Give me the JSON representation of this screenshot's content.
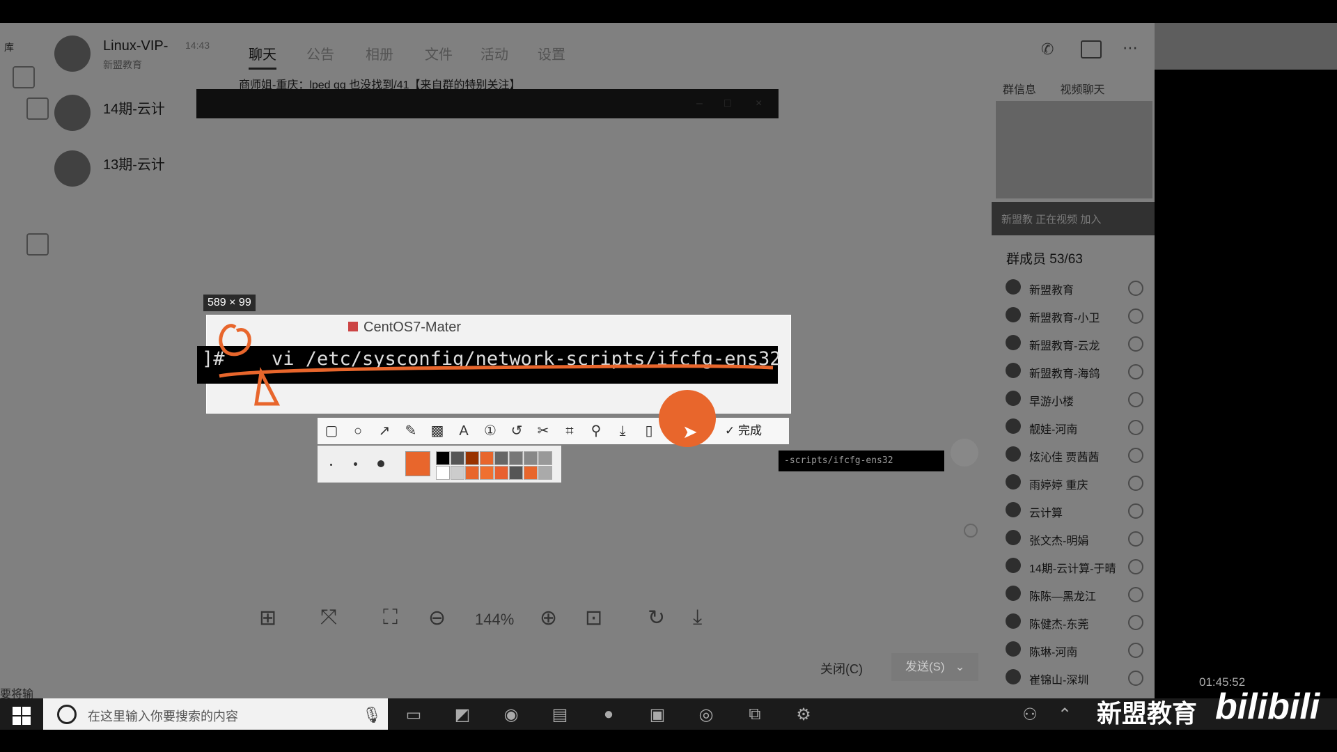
{
  "chat_list": [
    {
      "title": "Linux-VIP-",
      "subtitle": "新盟教育",
      "time": "14:43"
    },
    {
      "title": "14期-云计",
      "subtitle": "",
      "time": ""
    },
    {
      "title": "13期-云计",
      "subtitle": "",
      "time": ""
    }
  ],
  "tabs": {
    "chat": "聊天",
    "t2": "公告",
    "t3": "相册",
    "t4": "文件",
    "t5": "活动",
    "t6": "设置"
  },
  "notice": "商师姐-重庆：lped qq 也没找到/41【来自群的特别关注】",
  "group_panel": {
    "tab_info": "群信息",
    "tab_video": "视频聊天",
    "video_bar": "新盟教  正在视频   加入",
    "members_title": "群成员 53/63",
    "members": [
      "新盟教育",
      "新盟教育-小卫",
      "新盟教育-云龙",
      "新盟教育-海鸽",
      "早游小楼",
      "靓娃-河南",
      "炫沁佳   贾茜茜",
      "雨婷婷 重庆",
      "云计算",
      "张文杰-明娟",
      "14期-云计算-于晴",
      "陈陈—黑龙江",
      "陈健杰-东莞",
      "陈琳-河南",
      "崔锦山-深圳"
    ]
  },
  "screenshot_tool": {
    "size_label": "589 × 99",
    "terminal_title": "CentOS7-Mater",
    "terminal_prompt": "]#",
    "terminal_command": "vi /etc/sysconfig/network-scripts/ifcfg-ens32",
    "done_label": "完成",
    "preview_chip": "-scripts/ifcfg-ens32",
    "accent_color": "#e8662c",
    "palette_colors": [
      "#000000",
      "#555555",
      "#993300",
      "#e8662c",
      "#666666",
      "#777777",
      "#888888",
      "#999999",
      "#ffffff",
      "#cccccc",
      "#e8662c",
      "#f07030",
      "#e86030",
      "#555555",
      "#e8662c",
      "#aaaaaa"
    ]
  },
  "viewer": {
    "zoom": "144%",
    "close_label": "关闭(C)",
    "send_label": "发送(S)"
  },
  "status_strip": "要将输",
  "taskbar": {
    "search_placeholder": "在这里输入你要搜索的内容",
    "clock": "01:45:52"
  },
  "watermark": {
    "brand": "新盟教育",
    "site": "bilibili"
  }
}
